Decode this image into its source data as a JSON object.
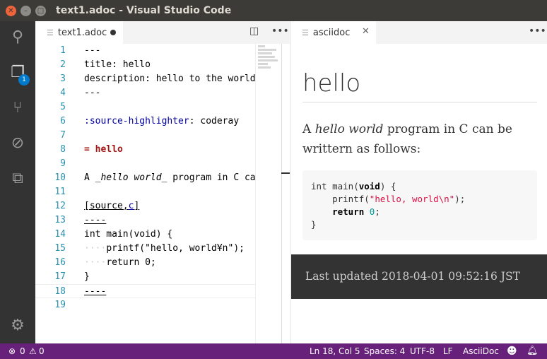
{
  "window": {
    "title": "text1.adoc - Visual Studio Code"
  },
  "activity": {
    "explorer_badge": "1"
  },
  "editor": {
    "tab_label": "text1.adoc",
    "lines": [
      {
        "n": "1",
        "segs": [
          {
            "t": "---",
            "c": ""
          }
        ]
      },
      {
        "n": "2",
        "segs": [
          {
            "t": "title: hello",
            "c": ""
          }
        ]
      },
      {
        "n": "3",
        "segs": [
          {
            "t": "description: hello to the world",
            "c": ""
          }
        ]
      },
      {
        "n": "4",
        "segs": [
          {
            "t": "---",
            "c": ""
          }
        ]
      },
      {
        "n": "5",
        "segs": []
      },
      {
        "n": "6",
        "segs": [
          {
            "t": ":source-highlighter",
            "c": "attr"
          },
          {
            "t": ": coderay",
            "c": ""
          }
        ]
      },
      {
        "n": "7",
        "segs": []
      },
      {
        "n": "8",
        "segs": [
          {
            "t": "= hello",
            "c": "kw-red"
          }
        ]
      },
      {
        "n": "9",
        "segs": []
      },
      {
        "n": "10",
        "segs": [
          {
            "t": "A ",
            "c": ""
          },
          {
            "t": "_hello world_",
            "c": "it"
          },
          {
            "t": " program in C can",
            "c": ""
          }
        ]
      },
      {
        "n": "11",
        "segs": []
      },
      {
        "n": "12",
        "segs": [
          {
            "t": "[source,",
            "c": "ul"
          },
          {
            "t": "c",
            "c": "ul attr"
          },
          {
            "t": "]",
            "c": "ul"
          }
        ]
      },
      {
        "n": "13",
        "segs": [
          {
            "t": "----",
            "c": "ul"
          }
        ]
      },
      {
        "n": "14",
        "segs": [
          {
            "t": "int main(void) {",
            "c": ""
          }
        ]
      },
      {
        "n": "15",
        "segs": [
          {
            "t": "····",
            "c": "guide"
          },
          {
            "t": "printf(\"hello, world¥n\");",
            "c": ""
          }
        ]
      },
      {
        "n": "16",
        "segs": [
          {
            "t": "····",
            "c": "guide"
          },
          {
            "t": "return 0;",
            "c": ""
          }
        ]
      },
      {
        "n": "17",
        "segs": [
          {
            "t": "}",
            "c": ""
          }
        ]
      },
      {
        "n": "18",
        "segs": [
          {
            "t": "----",
            "c": "ul"
          }
        ]
      },
      {
        "n": "19",
        "segs": []
      }
    ]
  },
  "preview": {
    "tab_label": "asciidoc",
    "heading": "hello",
    "para_pre": "A ",
    "para_em": "hello world",
    "para_post": " program in C can be writtern as follows:",
    "code": {
      "l1a": "int main(",
      "l1b": "void",
      "l1c": ") {",
      "l2a": "    printf(",
      "l2b": "\"hello, world\\n\"",
      "l2c": ");",
      "l3a": "    ",
      "l3b": "return",
      "l3c": " ",
      "l3d": "0",
      "l3e": ";",
      "l4": "}"
    },
    "footer": "Last updated 2018-04-01 09:52:16 JST"
  },
  "status": {
    "errors": "0",
    "warnings": "0",
    "position": "Ln 18, Col 5",
    "spaces": "Spaces: 4",
    "encoding": "UTF-8",
    "eol": "LF",
    "language": "AsciiDoc"
  }
}
